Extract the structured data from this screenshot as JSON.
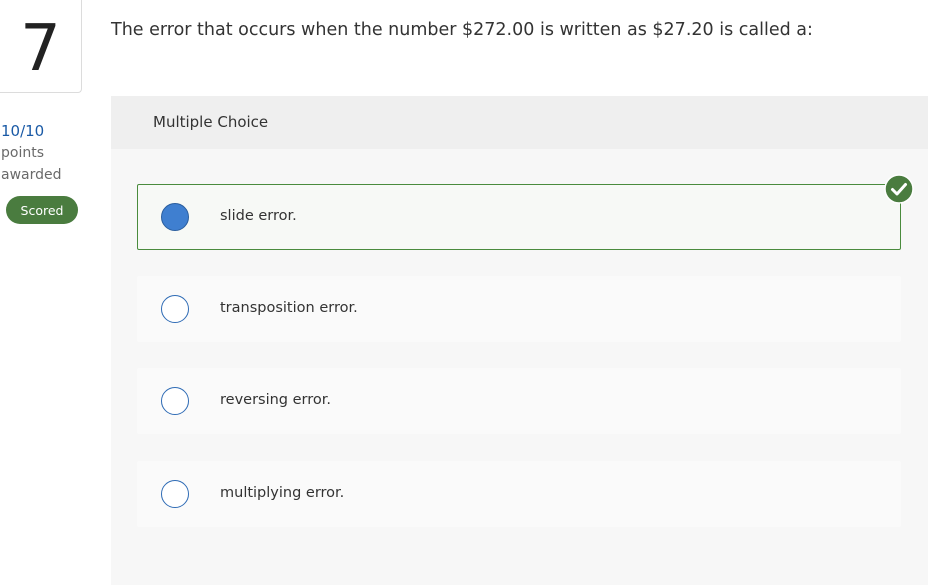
{
  "question": {
    "number": "7",
    "text": "The error that occurs when the number $272.00 is written as $27.20 is called a:"
  },
  "score": {
    "points": "10/10",
    "points_label": "points",
    "awarded_label": "awarded",
    "badge": "Scored"
  },
  "panel": {
    "title": "Multiple Choice"
  },
  "options": [
    {
      "label": "slide error.",
      "selected": true,
      "correct": true
    },
    {
      "label": "transposition error.",
      "selected": false
    },
    {
      "label": "reversing error.",
      "selected": false
    },
    {
      "label": "multiplying error.",
      "selected": false
    }
  ],
  "colors": {
    "accent_blue": "#3f7fd0",
    "correct_green": "#4a7c3f",
    "score_blue": "#1a5aa6"
  },
  "icons": {
    "correct": "check-circle-icon"
  }
}
